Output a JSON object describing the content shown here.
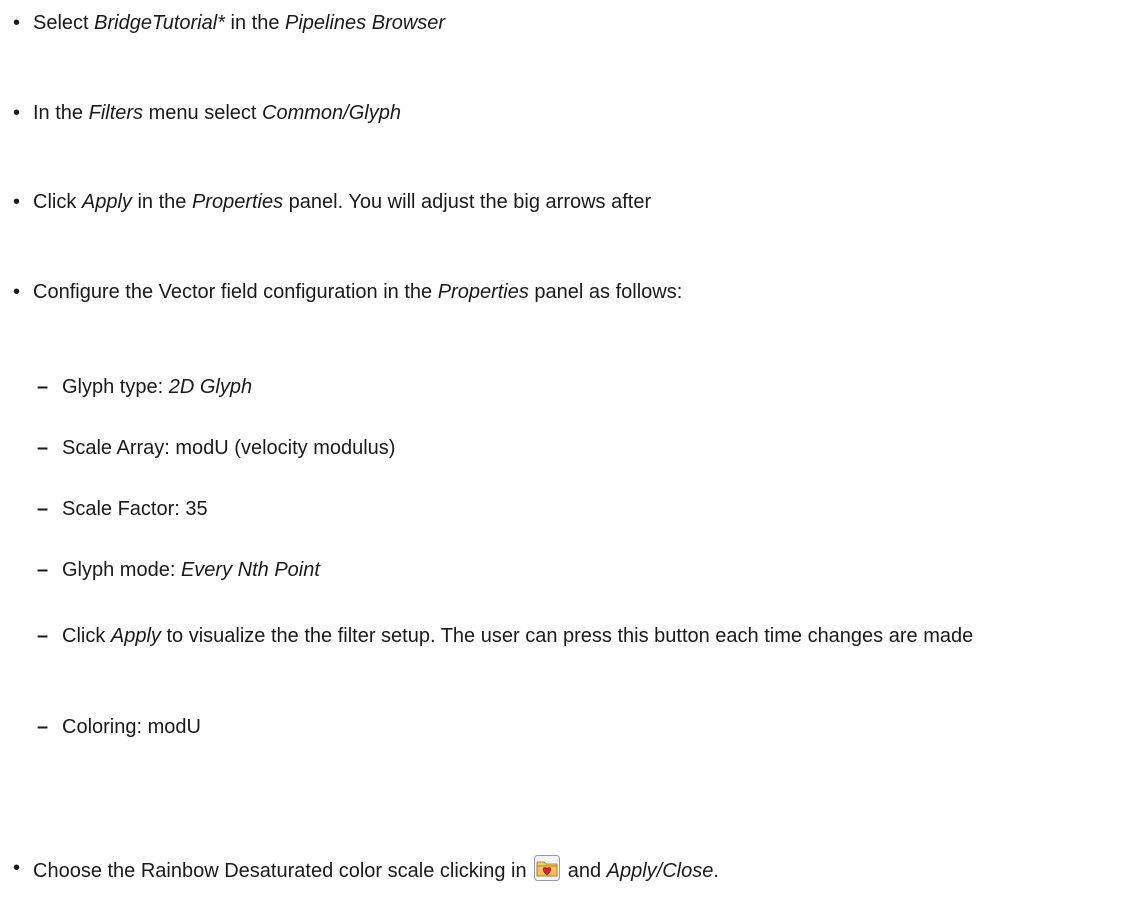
{
  "steps": [
    {
      "parts": [
        "Select ",
        "BridgeTutorial*",
        " in the ",
        "Pipelines Browser"
      ]
    },
    {
      "parts": [
        "In the ",
        "Filters",
        " menu select ",
        "Common/Glyph"
      ]
    },
    {
      "parts": [
        "Click ",
        "Apply",
        " in the ",
        "Properties",
        " panel. You will adjust the big arrows after"
      ]
    },
    {
      "parts": [
        "Configure the Vector field configuration in the ",
        "Properties",
        " panel as follows:"
      ]
    }
  ],
  "substeps": [
    {
      "parts": [
        "Glyph type: ",
        "2D Glyph"
      ]
    },
    {
      "parts": [
        "Scale Array: modU (velocity modulus)"
      ]
    },
    {
      "parts": [
        "Scale Factor: 35"
      ]
    },
    {
      "parts": [
        "Glyph mode: ",
        "Every Nth Point"
      ]
    },
    {
      "parts": [
        "Click ",
        "Apply",
        " to visualize the the filter setup.  The user can press this button each time changes are made"
      ]
    },
    {
      "parts": [
        "Coloring: modU"
      ]
    }
  ],
  "final_step": {
    "parts": [
      "Choose the Rainbow Desaturated color scale clicking in ",
      " and ",
      "Apply/Close",
      "."
    ],
    "icon": "choose-preset-icon"
  },
  "bullet_symbol": "•",
  "dash_symbol": "–",
  "colors": {
    "text": "#1a1a1a",
    "icon_folder": "#e8b64a",
    "icon_heart": "#d9262b"
  }
}
